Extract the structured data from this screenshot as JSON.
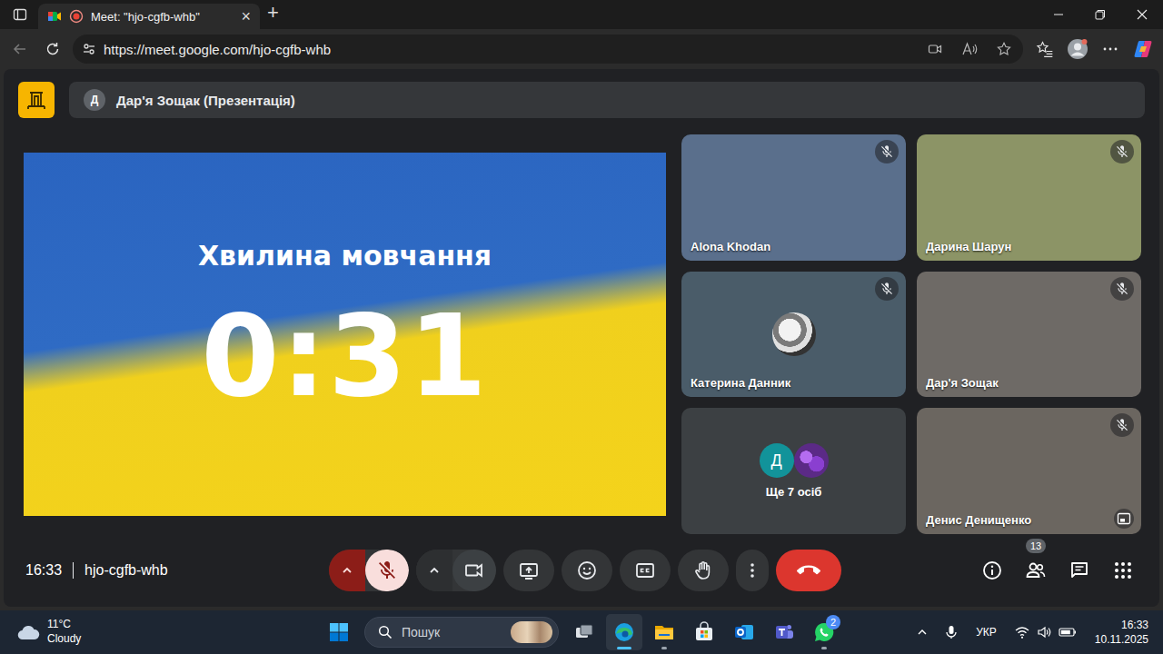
{
  "browser": {
    "tabs": [
      {
        "title": "Meet: \"hjo-cgfb-whb\"",
        "recording": true,
        "selected": true,
        "close": "×"
      }
    ],
    "new_tab": "+",
    "back_enabled": false,
    "url": "https://meet.google.com/hjo-cgfb-whb"
  },
  "meet": {
    "presenter": {
      "avatar": "Д",
      "label": "Дар'я Зощак (Презентація)"
    },
    "presentation": {
      "title": "Хвилина мовчання",
      "timer": "0:31"
    },
    "tiles": [
      {
        "kind": "video",
        "name": "Alona Khodan",
        "muted": true,
        "self_view": false,
        "color": "#5a6f8c",
        "avatars": []
      },
      {
        "kind": "video",
        "name": "Дарина Шарун",
        "muted": true,
        "self_view": false,
        "color": "#8c9466",
        "avatars": []
      },
      {
        "kind": "avatar",
        "name": "Катерина Данник",
        "muted": true,
        "self_view": false,
        "color": "#4a5c69",
        "avatars": []
      },
      {
        "kind": "video",
        "name": "Дар'я Зощак",
        "muted": true,
        "self_view": false,
        "color": "#6e6a66",
        "avatars": []
      },
      {
        "kind": "more",
        "name": "Ще 7 осіб",
        "muted": false,
        "self_view": false,
        "color": "#3c4043",
        "avatars": [
          {
            "kind": "letter",
            "text": "Д",
            "color": "#12939a"
          },
          {
            "kind": "picture",
            "text": "",
            "color": "#5b2a86"
          }
        ]
      },
      {
        "kind": "video",
        "name": "Денис Денищенко",
        "muted": true,
        "self_view": true,
        "color": "#6b6660",
        "avatars": []
      }
    ],
    "controls": {
      "time": "16:33",
      "code": "hjo-cgfb-whb",
      "mic_muted": true,
      "camera_on": true,
      "people_count": "13"
    }
  },
  "taskbar": {
    "weather": {
      "temp": "11°C",
      "condition": "Cloudy"
    },
    "search_placeholder": "Пошук",
    "apps": [
      {
        "name": "task-view",
        "running": false,
        "active": false,
        "badge": ""
      },
      {
        "name": "edge",
        "running": true,
        "active": true,
        "badge": ""
      },
      {
        "name": "explorer",
        "running": true,
        "active": false,
        "badge": ""
      },
      {
        "name": "store",
        "running": false,
        "active": false,
        "badge": ""
      },
      {
        "name": "outlook",
        "running": false,
        "active": false,
        "badge": ""
      },
      {
        "name": "teams",
        "running": false,
        "active": false,
        "badge": ""
      },
      {
        "name": "whatsapp",
        "running": true,
        "active": false,
        "badge": "2"
      }
    ],
    "language": "УКР",
    "time": "16:33",
    "date": "10.11.2025"
  }
}
